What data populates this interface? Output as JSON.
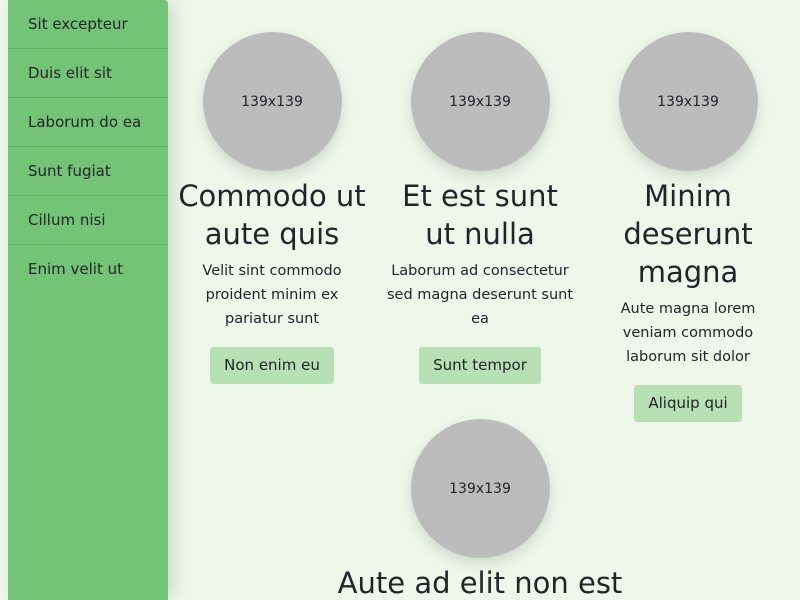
{
  "sidebar": {
    "items": [
      {
        "label": "Sit excepteur"
      },
      {
        "label": "Duis elit sit"
      },
      {
        "label": "Laborum do ea"
      },
      {
        "label": "Sunt fugiat"
      },
      {
        "label": "Cillum nisi"
      },
      {
        "label": "Enim velit ut"
      }
    ]
  },
  "cards": [
    {
      "image_label": "139x139",
      "title": "Commodo ut aute quis",
      "text": "Velit sint commodo proident minim ex pariatur sunt",
      "button": "Non enim eu"
    },
    {
      "image_label": "139x139",
      "title": "Et est sunt ut nulla",
      "text": "Laborum ad consectetur sed magna deserunt sunt ea",
      "button": "Sunt tempor"
    },
    {
      "image_label": "139x139",
      "title": "Minim deserunt magna",
      "text": "Aute magna lorem veniam commodo laborum sit dolor",
      "button": "Aliquip qui"
    },
    {
      "image_label": "139x139",
      "title": "Aute ad elit non est"
    }
  ]
}
